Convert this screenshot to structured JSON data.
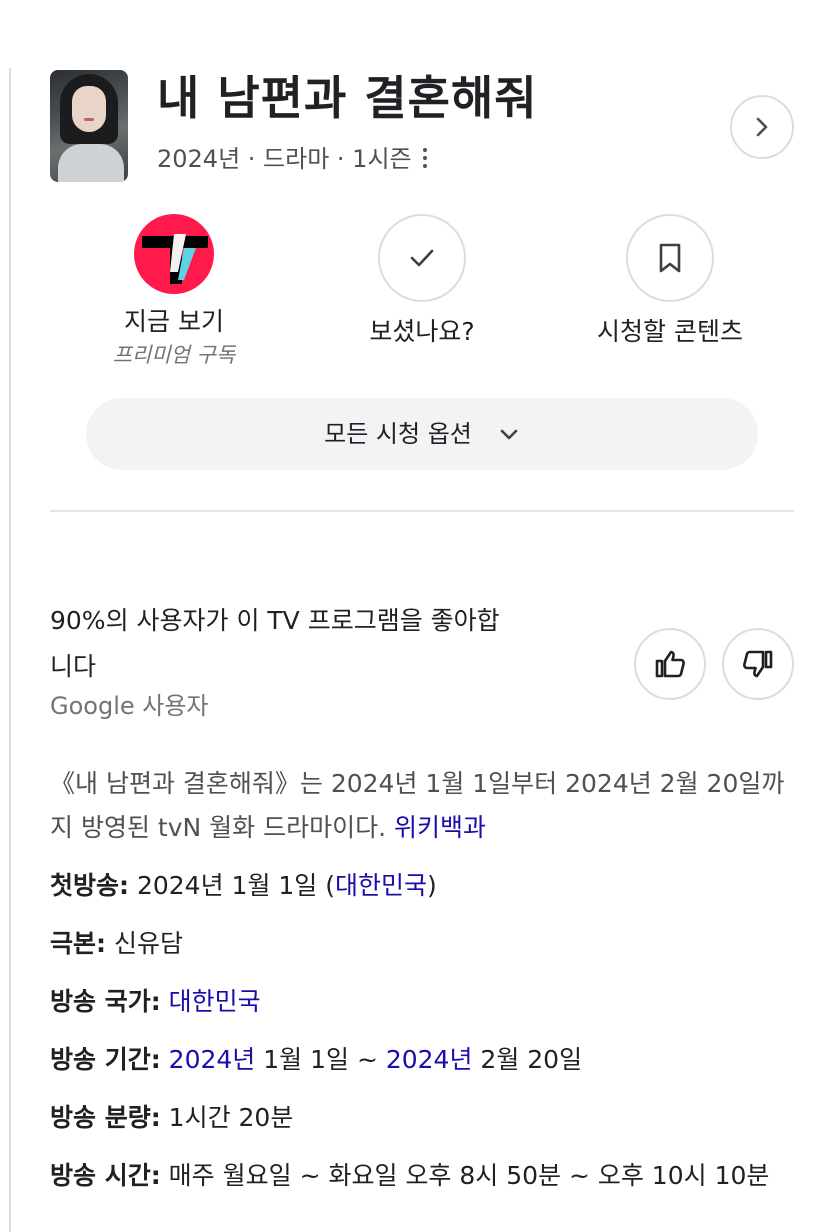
{
  "header": {
    "title": "내 남편과 결혼해줘",
    "meta": "2024년 · 드라마 · 1시즌"
  },
  "actions": {
    "watch_now": {
      "label": "지금 보기",
      "sublabel": "프리미엄 구독"
    },
    "watched": {
      "label": "보셨나요?"
    },
    "watchlist": {
      "label": "시청할 콘텐츠"
    }
  },
  "all_options_label": "모든 시청 옵션",
  "rating": {
    "text": "90%의 사용자가 이 TV 프로그램을 좋아합니다",
    "source": "Google 사용자"
  },
  "description": {
    "text": "《내 남편과 결혼해줘》는 2024년 1월 1일부터 2024년 2월 20일까지 방영된 tvN 월화 드라마이다.",
    "link": "위키백과"
  },
  "facts": {
    "first_air": {
      "label": "첫방송",
      "value": "2024년 1월 1일 (",
      "link": "대한민국",
      "suffix": ")"
    },
    "writer": {
      "label": "극본",
      "value": "신유담"
    },
    "country": {
      "label": "방송 국가",
      "link": "대한민국"
    },
    "period": {
      "label": "방송 기간",
      "link1": "2024년",
      "mid": " 1월 1일 ~ ",
      "link2": "2024년",
      "end": " 2월 20일"
    },
    "runtime": {
      "label": "방송 분량",
      "value": "1시간 20분"
    },
    "schedule": {
      "label": "방송 시간",
      "value": "매주 월요일 ~ 화요일 오후 8시 50분 ~ 오후 10시 10분"
    }
  },
  "colors": {
    "link": "#1a0dab",
    "tving_brand": "#ff1a4b",
    "button_bg": "#f1f3f4"
  },
  "icons": [
    "chevron-right-icon",
    "more-vert-icon",
    "tving-logo",
    "check-icon",
    "bookmark-icon",
    "chevron-down-icon",
    "thumbs-up-icon",
    "thumbs-down-icon"
  ]
}
